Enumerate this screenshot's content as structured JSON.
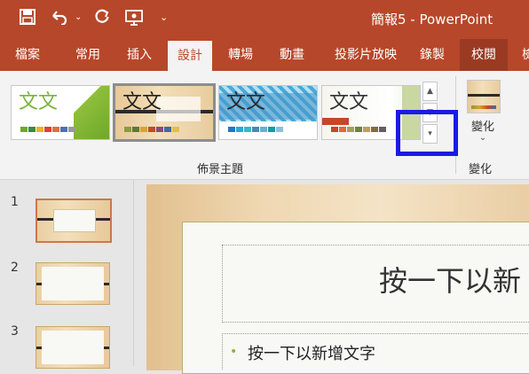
{
  "window": {
    "title": "簡報5 - PowerPoint"
  },
  "qat": {
    "save_icon": "save-icon",
    "undo_icon": "undo-icon",
    "redo_icon": "redo-icon",
    "present_icon": "present-icon",
    "customize_icon": "customize-icon"
  },
  "tabs": [
    "檔案",
    "常用",
    "插入",
    "設計",
    "轉場",
    "動畫",
    "投影片放映",
    "錄製",
    "校閱",
    "檢"
  ],
  "ribbon": {
    "themes": [
      {
        "text": "文文"
      },
      {
        "text": "文文"
      },
      {
        "text": "文文"
      },
      {
        "text": "文文"
      }
    ],
    "themes_group_label": "佈景主題",
    "variants_button_label": "變化",
    "variants_group_label": "變化"
  },
  "slide_numbers": [
    "1",
    "2",
    "3"
  ],
  "slide": {
    "title_placeholder": "按一下以新",
    "body_placeholder": "按一下以新增文字"
  }
}
